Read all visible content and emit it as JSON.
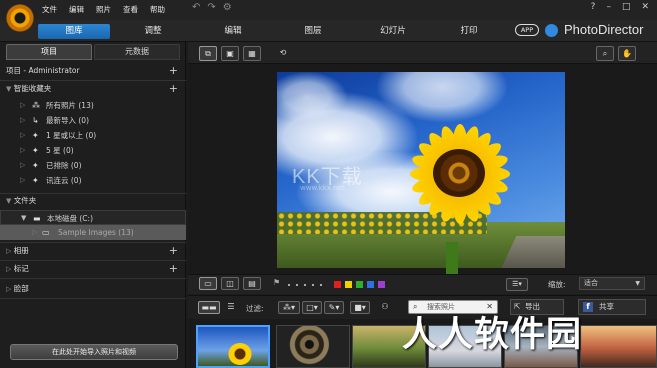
{
  "menu": {
    "items": [
      "文件",
      "编辑",
      "照片",
      "查看",
      "帮助"
    ]
  },
  "window_controls": {
    "help": "?",
    "minimize": "–",
    "maximize": "□",
    "close": "✕"
  },
  "modules": {
    "tabs": [
      "图库",
      "调整",
      "编辑",
      "图层",
      "幻灯片",
      "打印"
    ],
    "active": "图库"
  },
  "brand": {
    "app_badge": "APP",
    "name": "PhotoDirector"
  },
  "left_panel": {
    "tabs": [
      "项目",
      "元数据"
    ],
    "project_header": "项目 - Administrator",
    "smart_collections_header": "智能收藏夹",
    "smart_collections": [
      {
        "label": "所有照片 (13)"
      },
      {
        "label": "最新导入 (0)"
      },
      {
        "label": "1 星或以上 (0)"
      },
      {
        "label": "5 星 (0)"
      },
      {
        "label": "已排除 (0)"
      },
      {
        "label": "讯连云 (0)"
      }
    ],
    "folders_header": "文件夹",
    "folders": [
      {
        "label": "本地磁盘 (C:)"
      },
      {
        "label": "Sample Images (13)"
      }
    ],
    "albums_header": "相册",
    "tags_header": "标记",
    "faces_header": "脸部",
    "import_button": "在此处开始导入照片和视频"
  },
  "photo_watermark": {
    "text": "KK下载",
    "url": "www.kkx.net"
  },
  "bottom_toolbar": {
    "zoom_label": "缩放:",
    "zoom_value": "适合",
    "filter_label": "过滤:",
    "search_placeholder": "搜索照片",
    "export_label": "导出",
    "share_label": "共享"
  },
  "overlay_watermark": "人人软件园",
  "colors": {
    "accent": "#2d86d3",
    "label_colors": [
      "#e02020",
      "#f0d000",
      "#2fae2f",
      "#2f6fe0",
      "#9b3fd1"
    ]
  }
}
